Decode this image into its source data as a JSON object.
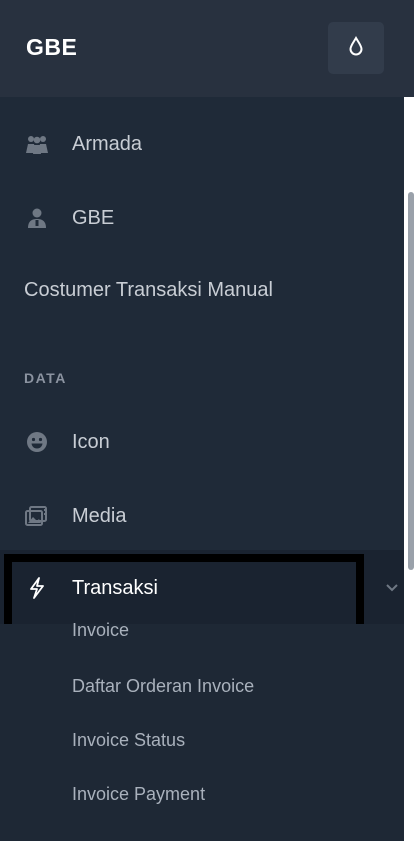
{
  "app": {
    "brand": "GBE"
  },
  "colors": {
    "sidebar_bg": "#1f2a38",
    "topbar_bg": "#28313f",
    "text_primary": "#ffffff",
    "text_secondary": "#c8cdd4",
    "section_title": "#8b93a0"
  },
  "header": {
    "theme_toggle_icon": "drop-icon"
  },
  "menu": {
    "items": [
      {
        "label": "Armada",
        "icon": "users-icon"
      },
      {
        "label": "GBE",
        "icon": "user-tie-icon"
      },
      {
        "label": "Costumer Transaksi Manual",
        "icon": ""
      }
    ],
    "section_data": "DATA",
    "data_items": [
      {
        "label": "Icon",
        "icon": "smile-icon"
      },
      {
        "label": "Media",
        "icon": "media-icon"
      }
    ],
    "active": {
      "label": "Transaksi",
      "icon": "bolt-icon",
      "expanded_icon": "chevron-down-icon"
    },
    "submenu": [
      {
        "label": "Invoice"
      },
      {
        "label": "Daftar Orderan Invoice"
      },
      {
        "label": "Invoice Status"
      },
      {
        "label": "Invoice Payment"
      }
    ]
  }
}
